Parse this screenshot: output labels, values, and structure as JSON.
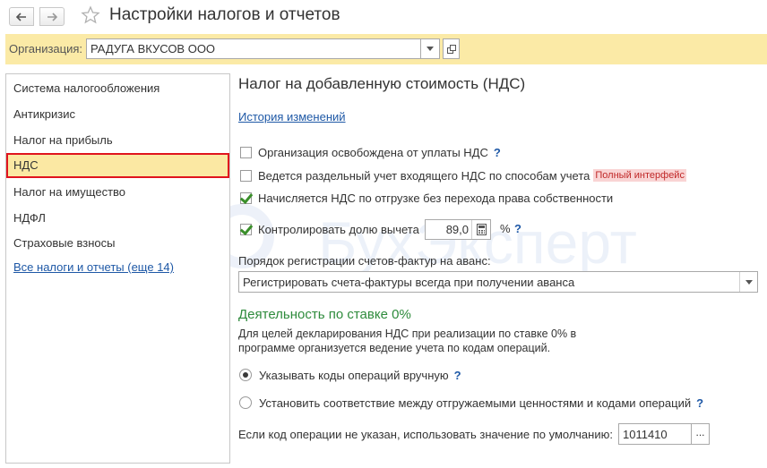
{
  "window": {
    "title": "Настройки налогов и отчетов"
  },
  "organization": {
    "label": "Организация:",
    "value": "РАДУГА ВКУСОВ ООО"
  },
  "sidebar": {
    "items": [
      {
        "label": "Система налогообложения"
      },
      {
        "label": "Антикризис"
      },
      {
        "label": "Налог на прибыль"
      },
      {
        "label": "НДС"
      },
      {
        "label": "Налог на имущество"
      },
      {
        "label": "НДФЛ"
      },
      {
        "label": "Страховые взносы"
      }
    ],
    "all_link": "Все налоги и отчеты (еще 14)"
  },
  "main": {
    "title": "Налог на добавленную стоимость (НДС)",
    "history_link": "История изменений",
    "checkboxes": [
      {
        "label": "Организация освобождена от уплаты НДС",
        "checked": false,
        "help": "?"
      },
      {
        "label": "Ведется раздельный учет входящего НДС по способам учета",
        "checked": false,
        "badge": "Полный интерфейс"
      },
      {
        "label": "Начисляется НДС по отгрузке без перехода права собственности",
        "checked": true
      },
      {
        "label": "Контролировать долю вычета",
        "checked": true
      }
    ],
    "deduction_share": {
      "value": "89,0",
      "unit": "%",
      "help": "?"
    },
    "invoice_order": {
      "label": "Порядок регистрации счетов-фактур на аванс:",
      "value": "Регистрировать счета-фактуры всегда при получении аванса"
    },
    "zero_rate": {
      "title": "Деятельность по ставке 0%",
      "description": "Для целей декларирования НДС при реализации по ставке 0% в программе организуется ведение учета по кодам операций.",
      "options": [
        {
          "label": "Указывать коды операций вручную",
          "selected": true,
          "help": "?"
        },
        {
          "label": "Установить соответствие между отгружаемыми ценностями и кодами операций",
          "selected": false,
          "help": "?"
        }
      ],
      "default_code_label": "Если код операции не указан, использовать значение по умолчанию:",
      "default_code_value": "1011410",
      "select_button": "..."
    }
  },
  "watermark": {
    "text": "БухЭксперт"
  },
  "colors": {
    "org_bar": "#fbeaa6",
    "active_item": "#fbe8a3",
    "active_border": "#e0141e",
    "link": "#1e58a6",
    "section_title": "#2e8b3c",
    "check": "#3a8f2a",
    "badge_bg": "#f9d4d4"
  }
}
